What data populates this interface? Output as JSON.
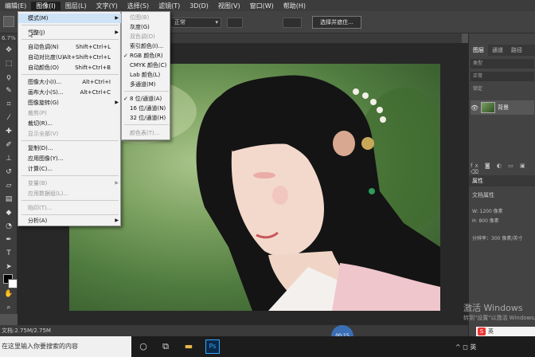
{
  "menubar": {
    "items": [
      "编辑(E)",
      "图像(I)",
      "图层(L)",
      "文字(Y)",
      "选择(S)",
      "滤镜(T)",
      "3D(D)",
      "视图(V)",
      "窗口(W)",
      "帮助(H)"
    ],
    "active_index": 1
  },
  "options": {
    "mode_value": "正常",
    "button_label": "选择并遮住..."
  },
  "document_tab": {
    "text": "6.7% R"
  },
  "image_menu": {
    "items": [
      {
        "label": "模式(M)",
        "shortcut": "",
        "submenu": true,
        "disabled": false,
        "highlighted": true
      },
      {
        "label": "调整(J)",
        "shortcut": "",
        "submenu": true,
        "disabled": false
      },
      {
        "label": "自动色调(N)",
        "shortcut": "Shift+Ctrl+L",
        "submenu": false,
        "disabled": false
      },
      {
        "label": "自动对比度(U)",
        "shortcut": "Alt+Shift+Ctrl+L",
        "submenu": false,
        "disabled": false
      },
      {
        "label": "自动颜色(O)",
        "shortcut": "Shift+Ctrl+B",
        "submenu": false,
        "disabled": false
      },
      {
        "label": "图像大小(I)...",
        "shortcut": "Alt+Ctrl+I",
        "submenu": false,
        "disabled": false
      },
      {
        "label": "画布大小(S)...",
        "shortcut": "Alt+Ctrl+C",
        "submenu": false,
        "disabled": false
      },
      {
        "label": "图像旋转(G)",
        "shortcut": "",
        "submenu": true,
        "disabled": false
      },
      {
        "label": "裁剪(P)",
        "shortcut": "",
        "submenu": false,
        "disabled": true
      },
      {
        "label": "裁切(R)...",
        "shortcut": "",
        "submenu": false,
        "disabled": false
      },
      {
        "label": "显示全部(V)",
        "shortcut": "",
        "submenu": false,
        "disabled": true
      },
      {
        "label": "复制(D)...",
        "shortcut": "",
        "submenu": false,
        "disabled": false
      },
      {
        "label": "应用图像(Y)...",
        "shortcut": "",
        "submenu": false,
        "disabled": false
      },
      {
        "label": "计算(C)...",
        "shortcut": "",
        "submenu": false,
        "disabled": false
      },
      {
        "label": "变量(B)",
        "shortcut": "",
        "submenu": true,
        "disabled": true
      },
      {
        "label": "应用数据组(L)...",
        "shortcut": "",
        "submenu": false,
        "disabled": true
      },
      {
        "label": "陷印(T)...",
        "shortcut": "",
        "submenu": false,
        "disabled": true
      },
      {
        "label": "分析(A)",
        "shortcut": "",
        "submenu": true,
        "disabled": false
      }
    ]
  },
  "mode_submenu": {
    "items": [
      {
        "label": "位图(B)",
        "checked": false,
        "disabled": true
      },
      {
        "label": "灰度(G)",
        "checked": false,
        "disabled": false
      },
      {
        "label": "双色调(D)",
        "checked": false,
        "disabled": true
      },
      {
        "label": "索引颜色(I)...",
        "checked": false,
        "disabled": false
      },
      {
        "label": "RGB 颜色(R)",
        "checked": true,
        "disabled": false
      },
      {
        "label": "CMYK 颜色(C)",
        "checked": false,
        "disabled": false
      },
      {
        "label": "Lab 颜色(L)",
        "checked": false,
        "disabled": false
      },
      {
        "label": "多通道(M)",
        "checked": false,
        "disabled": false
      },
      {
        "label": "8 位/通道(A)",
        "checked": true,
        "disabled": false
      },
      {
        "label": "16 位/通道(N)",
        "checked": false,
        "disabled": false
      },
      {
        "label": "32 位/通道(H)",
        "checked": false,
        "disabled": false
      },
      {
        "label": "颜色表(T)...",
        "checked": false,
        "disabled": true
      }
    ]
  },
  "layers_panel": {
    "tabs": [
      "图层",
      "通道",
      "路径"
    ],
    "kind_label": "类型",
    "mode_label": "正常",
    "lock_label": "锁定",
    "layer_name": "背景",
    "bottom_icons": "fx ◙ ◐ ▭ ▣ ⌫"
  },
  "properties_panel": {
    "title": "属性",
    "doc_label": "文档属性",
    "width": "W: 1200 像素",
    "height": "H: 800 像素",
    "resolution": "分辨率：300 像素/英寸"
  },
  "status": {
    "text": "文档:2.75M/2.75M",
    "zoom_badge": "00:15"
  },
  "watermark": {
    "line1": "激活 Windows",
    "line2": "转到\"设置\"以激活 Windows。"
  },
  "ime": {
    "lang": "英"
  },
  "taskbar": {
    "search_placeholder": "在这里输入你要搜索的内容",
    "ps_label": "Ps",
    "tray_text": "^ ◻ 英"
  }
}
